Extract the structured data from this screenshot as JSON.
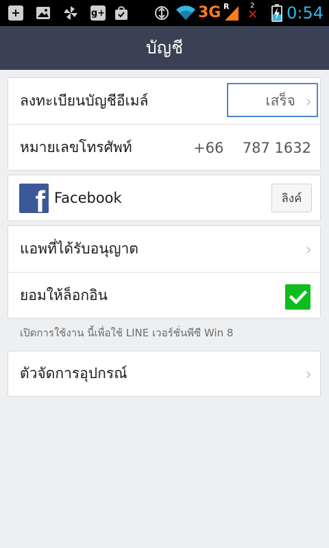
{
  "statusbar": {
    "network": "3G",
    "roaming": "R",
    "sim": "2",
    "time": "0:54"
  },
  "header": {
    "title": "บัญชี"
  },
  "account": {
    "email_label": "ลงทะเบียนบัญชีอีเมล์",
    "email_status": "เสร็จ",
    "phone_label": "หมายเลขโทรศัพท์",
    "phone_code": "+66",
    "phone_number": "787 1632"
  },
  "facebook": {
    "label": "Facebook",
    "link_button": "ลิงค์"
  },
  "apps": {
    "allowed_apps_label": "แอพที่ได้รับอนุญาต",
    "allow_login_label": "ยอมให้ล็อกอิน",
    "allow_login_checked": true,
    "hint": "เปิดการใช้งาน นี้เพื่อใช้ LINE เวอร์ชั่นพีซี Win 8"
  },
  "device": {
    "manager_label": "ตัวจัดการอุปกรณ์"
  },
  "colors": {
    "titlebar": "#3a4154",
    "checkbox": "#0fbe1e",
    "facebook": "#3b5998",
    "focus_border": "#4f86c9",
    "time": "#33b5e5"
  }
}
